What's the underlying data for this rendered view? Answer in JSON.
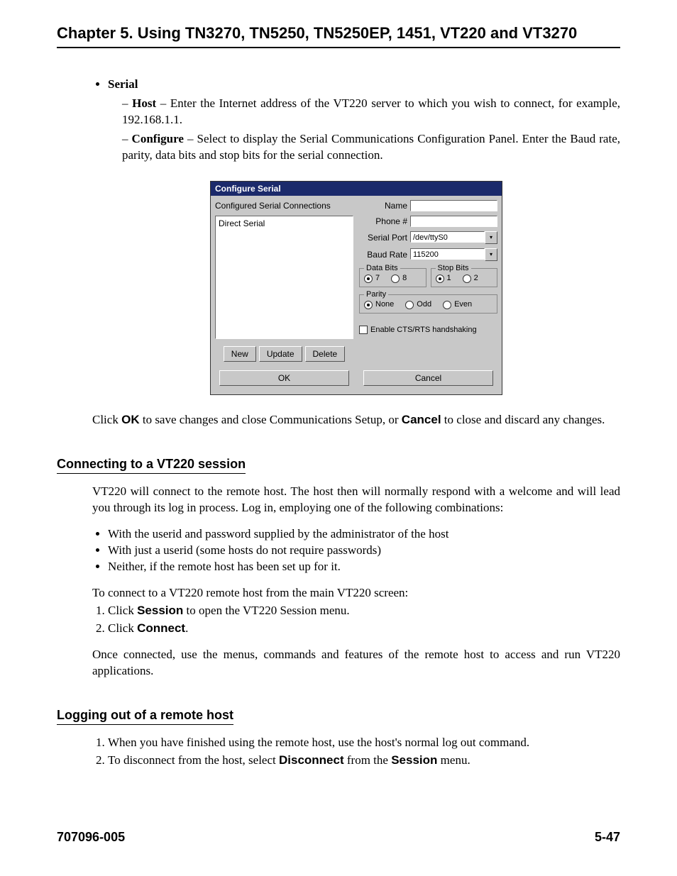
{
  "header": {
    "chapter_title": "Chapter 5.  Using  TN3270, TN5250, TN5250EP, 1451, VT220 and VT3270"
  },
  "serial": {
    "label": "Serial",
    "host_label": "Host",
    "host_text": " – Enter the Internet address of the VT220 server to which you wish to connect, for example, 192.168.1.1.",
    "configure_label": "Configure",
    "configure_text": " – Select to display the Serial Communications Configuration Panel. Enter the Baud rate, parity, data bits and stop bits for the serial connection."
  },
  "dialog": {
    "title": "Configure Serial",
    "left": {
      "list_label": "Configured Serial Connections",
      "list_item": "Direct Serial",
      "new_btn": "New",
      "update_btn": "Update",
      "delete_btn": "Delete"
    },
    "right": {
      "name_label": "Name",
      "name_value": "",
      "phone_label": "Phone #",
      "phone_value": "",
      "serialport_label": "Serial Port",
      "serialport_value": "/dev/ttyS0",
      "baud_label": "Baud Rate",
      "baud_value": "115200",
      "databits_legend": "Data Bits",
      "databits_7": "7",
      "databits_8": "8",
      "stopbits_legend": "Stop Bits",
      "stopbits_1": "1",
      "stopbits_2": "2",
      "parity_legend": "Parity",
      "parity_none": "None",
      "parity_odd": "Odd",
      "parity_even": "Even",
      "handshake_label": "Enable CTS/RTS handshaking"
    },
    "ok_btn": "OK",
    "cancel_btn": "Cancel"
  },
  "after_dialog": {
    "text_pre": "Click ",
    "ok": "OK",
    "text_mid": " to save changes and close Communications Setup, or ",
    "cancel": "Cancel",
    "text_post": " to close and discard any changes."
  },
  "section_connect": {
    "heading": "Connecting to a VT220 session",
    "intro": "VT220 will connect to the remote host. The host then will normally respond with a welcome and will lead you through its log in process. Log in, employing one of the following combinations:",
    "b1": "With the userid and password supplied by the administrator of the host",
    "b2": "With just a userid (some hosts do not require passwords)",
    "b3": "Neither, if the remote host has been set up for it.",
    "lead2": "To connect to a VT220 remote host from the main VT220 screen:",
    "step1_pre": "Click ",
    "step1_bold": "Session",
    "step1_post": " to open the VT220 Session menu.",
    "step2_pre": "Click ",
    "step2_bold": "Connect",
    "step2_post": ".",
    "outro": "Once connected, use the menus, commands and features of the remote host to access and run VT220 applications."
  },
  "section_logout": {
    "heading": "Logging out of a remote host",
    "step1": "When you have finished using the remote host, use the host's normal log out command.",
    "step2_pre": "To disconnect from the host, select ",
    "step2_b1": "Disconnect",
    "step2_mid": " from the ",
    "step2_b2": "Session",
    "step2_post": " menu."
  },
  "footer": {
    "docnum": "707096-005",
    "pagenum": "5-47"
  }
}
